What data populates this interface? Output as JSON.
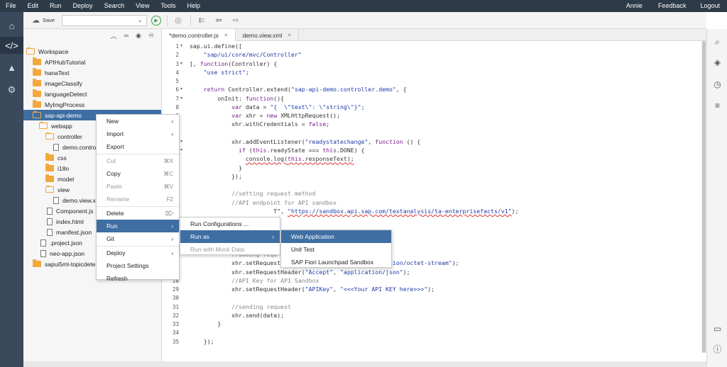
{
  "menubar": {
    "items": [
      "File",
      "Edit",
      "Run",
      "Deploy",
      "Search",
      "View",
      "Tools",
      "Help"
    ],
    "user": "Annie",
    "feedback": "Feedback",
    "logout": "Logout"
  },
  "toolbar": {
    "save_label": "Save"
  },
  "explorer": {
    "tree": [
      {
        "label": "Workspace",
        "kind": "folder-open",
        "depth": 0
      },
      {
        "label": "APIHubTutorial",
        "kind": "folder",
        "depth": 1
      },
      {
        "label": "hanaText",
        "kind": "folder",
        "depth": 1
      },
      {
        "label": "imageClassify",
        "kind": "folder",
        "depth": 1
      },
      {
        "label": "languageDetect",
        "kind": "folder",
        "depth": 1
      },
      {
        "label": "MyImgProcess",
        "kind": "folder",
        "depth": 1
      },
      {
        "label": "sap-api-demo",
        "kind": "folder-open",
        "depth": 1,
        "selected": true
      },
      {
        "label": "webapp",
        "kind": "folder-open",
        "depth": 2
      },
      {
        "label": "controller",
        "kind": "folder-open",
        "depth": 3
      },
      {
        "label": "demo.contro",
        "kind": "file",
        "depth": 4
      },
      {
        "label": "css",
        "kind": "folder",
        "depth": 3
      },
      {
        "label": "i18n",
        "kind": "folder",
        "depth": 3
      },
      {
        "label": "model",
        "kind": "folder",
        "depth": 3
      },
      {
        "label": "view",
        "kind": "folder-open",
        "depth": 3
      },
      {
        "label": "demo.view.x",
        "kind": "file",
        "depth": 4
      },
      {
        "label": "Component.js",
        "kind": "file",
        "depth": 3
      },
      {
        "label": "index.html",
        "kind": "file",
        "depth": 3
      },
      {
        "label": "manifest.json",
        "kind": "file",
        "depth": 3
      },
      {
        "label": ".project.json",
        "kind": "file",
        "depth": 2
      },
      {
        "label": "neo-app.json",
        "kind": "file",
        "depth": 2
      },
      {
        "label": "sapui5ml-topicdete",
        "kind": "folder",
        "depth": 1
      }
    ]
  },
  "tabs": [
    {
      "label": "*demo.controller.js",
      "active": true
    },
    {
      "label": "demo.view.xml",
      "active": false
    }
  ],
  "editor": {
    "lines": [
      {
        "n": "1",
        "fold": true,
        "html": "sap.ui.define(["
      },
      {
        "n": "2",
        "html": "    <span class='str'>\"sap/ui/core/mvc/Controller\"</span>"
      },
      {
        "n": "3",
        "fold": true,
        "html": "], <span class='kw'>function</span>(Controller) {"
      },
      {
        "n": "4",
        "html": "    <span class='str'>\"use strict\"</span>;"
      },
      {
        "n": "5",
        "html": ""
      },
      {
        "n": "6",
        "fold": true,
        "html": "    <span class='kw'>return</span> Controller.extend(<span class='str'>\"sap-api-demo.controller.demo\"</span>, {"
      },
      {
        "n": "7",
        "fold": true,
        "html": "        onInit: <span class='kw'>function</span>(){"
      },
      {
        "n": "8",
        "html": "            <span class='kw'>var</span> data = <span class='str'>\"{  \\\"text\\\": \\\"string\\\"}\"</span>;"
      },
      {
        "n": "9",
        "html": "            <span class='kw'>var</span> xhr = <span class='kw'>new</span> XMLHttpRequest();"
      },
      {
        "n": "10",
        "html": "            xhr.withCredentials = <span class='kw'>false</span>;"
      },
      {
        "n": "11",
        "html": ""
      },
      {
        "n": "12",
        "fold": true,
        "html": "            xhr.addEventListener(<span class='str'>\"readystatechange\"</span>, <span class='kw'>function</span> () {"
      },
      {
        "n": "13",
        "fold": true,
        "html": "              <span class='kw'>if</span> (<span class='kw'>this</span>.readyState === <span class='kw'>this</span>.DONE) {"
      },
      {
        "n": "14",
        "html": "                <span class='sq'>console.log(<span class='kw'>this</span>.responseText);</span>"
      },
      {
        "n": "15",
        "html": "              }"
      },
      {
        "n": "16",
        "html": "            });"
      },
      {
        "n": "17",
        "html": ""
      },
      {
        "n": "18",
        "html": "            <span class='cm'>//setting request method</span>"
      },
      {
        "n": "19",
        "html": "            <span class='cm'>//API endpoint for API sandbox</span>"
      },
      {
        "n": "20",
        "html": "                        T\", <span class='str sq'>\"https://sandbox.api.sap.com/textanalysis/ta-enterprisefacts/v1\"</span>);"
      },
      {
        "n": "21",
        "html": ""
      },
      {
        "n": "22",
        "html": ""
      },
      {
        "n": "23",
        "html": ""
      },
      {
        "n": "24",
        "html": ""
      },
      {
        "n": "25",
        "html": "            <span class='cm'>//adding requ</span>"
      },
      {
        "n": "26",
        "html": "            xhr.setRequestHeader(<span class='str'>\"Content-Type\"</span>, <span class='str'>\"application/octet-stream\"</span>);"
      },
      {
        "n": "27",
        "html": "            xhr.setRequestHeader(<span class='str'>\"Accept\"</span>, <span class='str'>\"application/json\"</span>);"
      },
      {
        "n": "28",
        "html": "            <span class='cm'>//API Key for API Sandbox</span>"
      },
      {
        "n": "29",
        "html": "            xhr.setRequestHeader(<span class='str'>\"APIKey\"</span>, <span class='str'>\"&lt;&lt;&lt;Your API KEY here&gt;&gt;&gt;\"</span>);"
      },
      {
        "n": "30",
        "html": ""
      },
      {
        "n": "31",
        "html": "            <span class='cm'>//sending request</span>"
      },
      {
        "n": "32",
        "html": "            xhr.send(data);"
      },
      {
        "n": "33",
        "html": "        }"
      },
      {
        "n": "34",
        "html": ""
      },
      {
        "n": "35",
        "html": "    });"
      }
    ]
  },
  "context_menu": {
    "items": [
      {
        "label": "New",
        "submenu": true
      },
      {
        "label": "Import",
        "submenu": true
      },
      {
        "label": "Export"
      },
      {
        "sep": true
      },
      {
        "label": "Cut",
        "shortcut": "⌘X",
        "disabled": true
      },
      {
        "label": "Copy",
        "shortcut": "⌘C"
      },
      {
        "label": "Paste",
        "shortcut": "⌘V",
        "disabled": true
      },
      {
        "label": "Rename",
        "shortcut": "F2",
        "disabled": true
      },
      {
        "sep": true
      },
      {
        "label": "Delete",
        "shortcut": "⌦"
      },
      {
        "label": "Run",
        "submenu": true,
        "highlighted": true
      },
      {
        "label": "Git",
        "submenu": true
      },
      {
        "sep": true
      },
      {
        "label": "Deploy",
        "submenu": true
      },
      {
        "label": "Project Settings"
      },
      {
        "label": "Refresh"
      }
    ]
  },
  "run_menu": {
    "items": [
      {
        "label": "Run Configurations ..."
      },
      {
        "label": "Run as",
        "submenu": true,
        "highlighted": true
      },
      {
        "label": "Run with Mock Data",
        "disabled": true
      }
    ]
  },
  "run_as_menu": {
    "items": [
      {
        "label": "Web Application",
        "highlighted": true
      },
      {
        "label": "Unit Test"
      },
      {
        "label": "SAP Fiori Launchpad Sandbox"
      }
    ]
  },
  "icons": {
    "left": [
      "home-icon",
      "code-icon",
      "learn-icon",
      "settings-icon"
    ],
    "right": [
      "search-icon",
      "api-icon",
      "history-icon",
      "outline-icon",
      "console-icon",
      "info-icon"
    ]
  }
}
